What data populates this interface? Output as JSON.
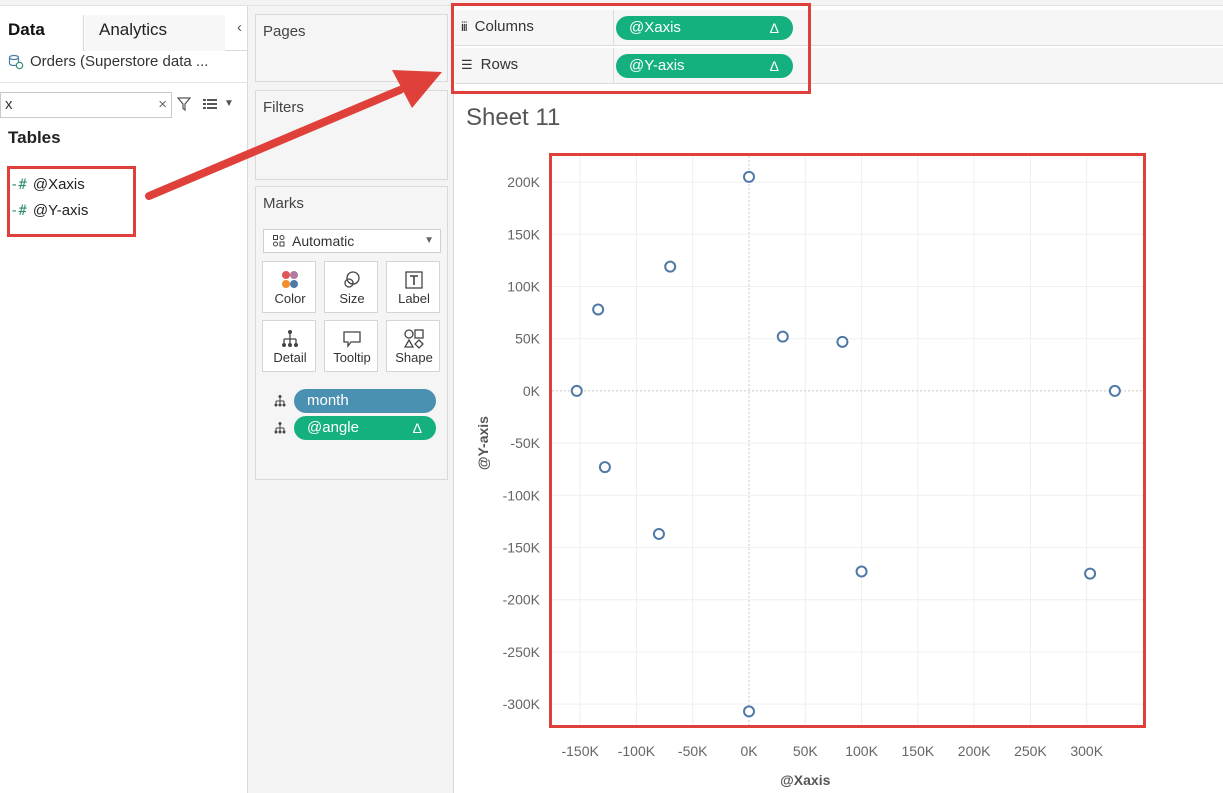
{
  "datapane": {
    "tab_data": "Data",
    "tab_analytics": "Analytics",
    "collapse_icon": "chevron-left",
    "datasource": "Orders (Superstore data ...",
    "search_value": "x",
    "search_clear": "×",
    "tables_heading": "Tables",
    "fields": [
      "@Xaxis",
      "@Y-axis"
    ]
  },
  "cards": {
    "pages": "Pages",
    "filters": "Filters",
    "marks": "Marks",
    "mark_type": "Automatic",
    "buttons": [
      "Color",
      "Size",
      "Label",
      "Detail",
      "Tooltip",
      "Shape"
    ],
    "detail_pills": [
      {
        "label": "month",
        "delta": ""
      },
      {
        "label": "@angle",
        "delta": "Δ"
      }
    ]
  },
  "shelves": {
    "columns_label": "Columns",
    "rows_label": "Rows",
    "columns_pill": "@Xaxis",
    "rows_pill": "@Y-axis",
    "delta": "Δ"
  },
  "sheet": {
    "title": "Sheet 11"
  },
  "colors": {
    "pill_green": "#14b07f",
    "pill_blue": "#4a90b0",
    "annotation_red": "#e0403a",
    "mark_stroke": "#4e79a7"
  },
  "chart_data": {
    "type": "scatter",
    "xlabel": "@Xaxis",
    "ylabel": "@Y-axis",
    "xlim": [
      -175000,
      350000
    ],
    "ylim": [
      -320000,
      225000
    ],
    "xticks": [
      -150000,
      -100000,
      -50000,
      0,
      50000,
      100000,
      150000,
      200000,
      250000,
      300000
    ],
    "xtick_labels": [
      "-150K",
      "-100K",
      "-50K",
      "0K",
      "50K",
      "100K",
      "150K",
      "200K",
      "250K",
      "300K"
    ],
    "yticks": [
      200000,
      150000,
      100000,
      50000,
      0,
      -50000,
      -100000,
      -150000,
      -200000,
      -250000,
      -300000
    ],
    "ytick_labels": [
      "200K",
      "150K",
      "100K",
      "50K",
      "0K",
      "-50K",
      "-100K",
      "-150K",
      "-200K",
      "-250K",
      "-300K"
    ],
    "grid": true,
    "points": [
      {
        "x": 0,
        "y": 205000
      },
      {
        "x": -70000,
        "y": 119000
      },
      {
        "x": -134000,
        "y": 78000
      },
      {
        "x": 30000,
        "y": 52000
      },
      {
        "x": 83000,
        "y": 47000
      },
      {
        "x": -153000,
        "y": 0
      },
      {
        "x": 325000,
        "y": 0
      },
      {
        "x": -128000,
        "y": -73000
      },
      {
        "x": -80000,
        "y": -137000
      },
      {
        "x": 100000,
        "y": -173000
      },
      {
        "x": 303000,
        "y": -175000
      },
      {
        "x": 0,
        "y": -307000
      }
    ]
  }
}
